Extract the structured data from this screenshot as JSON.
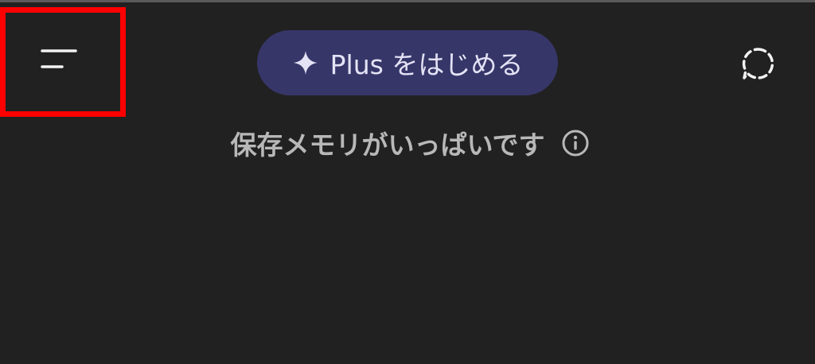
{
  "header": {
    "menu_icon": "hamburger-menu-icon",
    "upgrade_icon": "sparkle-icon",
    "upgrade_label": "Plus をはじめる",
    "temp_chat_icon": "dashed-chat-bubble-icon"
  },
  "notice": {
    "text": "保存メモリがいっぱいです",
    "info_icon": "info-icon"
  },
  "colors": {
    "background": "#212121",
    "upgrade_pill": "#373669",
    "highlight_box": "#ff0000",
    "notice_text": "#b8b8b8"
  }
}
